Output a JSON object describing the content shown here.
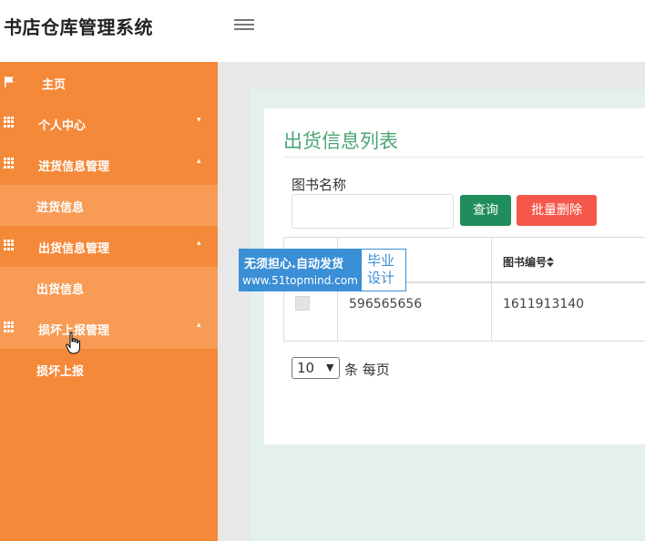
{
  "header": {
    "title": "书店仓库管理系统",
    "menu_icon": "hamburger-menu-icon"
  },
  "sidebar": {
    "items": [
      {
        "label": "主页",
        "icon": "flag-icon"
      },
      {
        "label": "个人中心",
        "icon": "grid-icon",
        "caret": "▾"
      },
      {
        "label": "进货信息管理",
        "icon": "grid-icon",
        "caret": "▴"
      },
      {
        "label": "进货信息"
      },
      {
        "label": "出货信息管理",
        "icon": "grid-icon",
        "caret": "▴"
      },
      {
        "label": "出货信息"
      },
      {
        "label": "损坏上报管理",
        "icon": "grid-icon",
        "caret": "▴"
      },
      {
        "label": "损坏上报"
      }
    ],
    "color": "#f5893a"
  },
  "main": {
    "title": "出货信息列表",
    "search": {
      "label": "图书名称",
      "value": ""
    },
    "buttons": {
      "query": "查询",
      "batch_delete": "批量删除"
    },
    "table": {
      "headers": [
        "",
        "",
        "图书编号"
      ],
      "sort_icon": "sort-icon",
      "rows": [
        [
          "",
          "596565656",
          "1611913140"
        ]
      ]
    },
    "pagination": {
      "page_size": "10",
      "suffix": "条 每页"
    }
  },
  "watermark": {
    "line1": "无须担心.自动发货",
    "line2": "www.51topmind.com",
    "side1": "毕业",
    "side2": "设计"
  },
  "colors": {
    "accent_green": "#4aa574",
    "query_button": "#1f8e5c",
    "delete_button": "#f5584a",
    "sidebar": "#f5893a"
  }
}
